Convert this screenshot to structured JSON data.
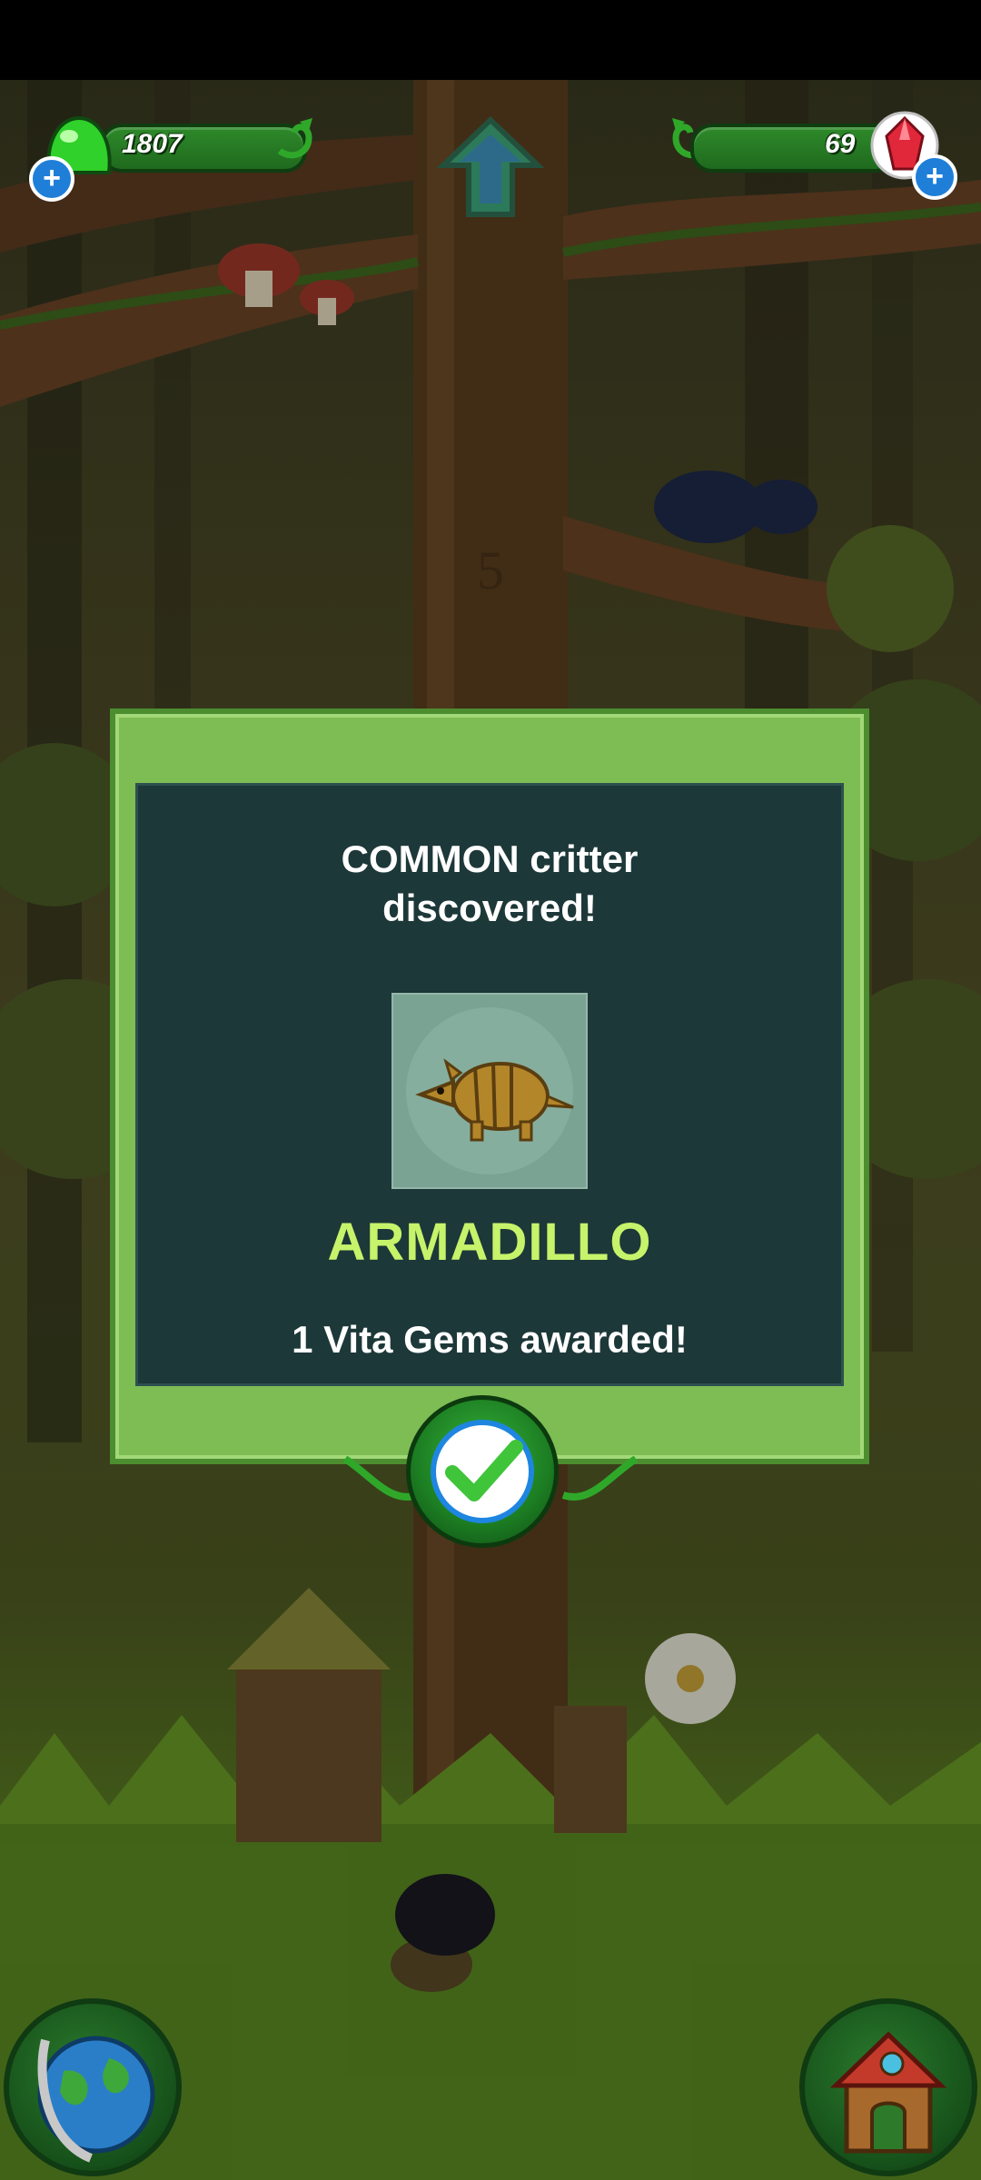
{
  "hud": {
    "slime_count": "1807",
    "gem_count": "69",
    "add_slime_icon": "plus-icon",
    "add_gem_icon": "plus-icon",
    "home_icon": "up-arrow-icon",
    "slime_icon": "green-slime-icon",
    "gem_icon": "red-gem-icon"
  },
  "dialog": {
    "heading": "COMMON critter discovered!",
    "critter_name": "ARMADILLO",
    "reward_text": "1 Vita Gems awarded!",
    "critter_image": "armadillo-icon",
    "confirm_icon": "checkmark-icon",
    "accent_color": "#c6f36a",
    "frame_color": "#7ebd54"
  },
  "bottom_nav": {
    "left_icon": "globe-icon",
    "right_icon": "house-icon"
  }
}
